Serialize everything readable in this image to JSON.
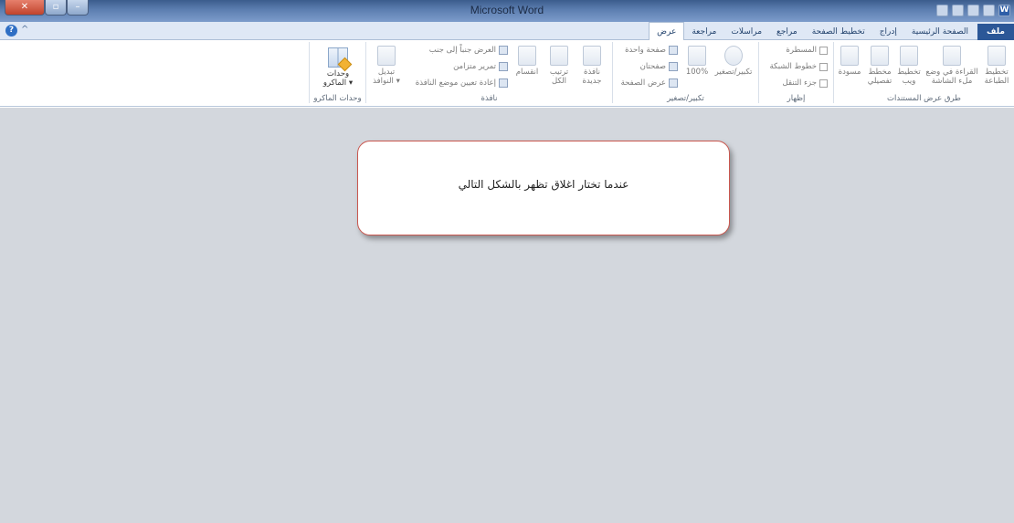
{
  "window": {
    "title": "Microsoft Word"
  },
  "tabs": [
    "ملف",
    "الصفحة الرئيسية",
    "إدراج",
    "تخطيط الصفحة",
    "مراجع",
    "مراسلات",
    "مراجعة",
    "عرض"
  ],
  "ribbon": {
    "document_views": {
      "name": "طرق عرض المستندات",
      "items": [
        "تخطيط الطباعة",
        "القراءة في وضع ملء الشاشة",
        "تخطيط ويب",
        "مخطط تفصيلي",
        "مسودة"
      ]
    },
    "show": {
      "name": "إظهار",
      "items": [
        "المسطرة",
        "خطوط الشبكة",
        "جزء التنقل"
      ]
    },
    "zoom": {
      "name": "تكبير/تصغير",
      "zoom_label": "تكبير/تصغير",
      "percent_label": "100%",
      "items": [
        "صفحة واحدة",
        "صفحتان",
        "عرض الصفحة"
      ]
    },
    "window_group": {
      "name": "نافذة",
      "new_window": "نافذة جديدة",
      "arrange_all": "ترتيب الكل",
      "split": "انقسام",
      "items": [
        "العرض جنباً إلى جنب",
        "تمرير متزامن",
        "إعادة تعيين موضع النافذة"
      ],
      "switch_windows": "تبديل النوافذ ▾"
    },
    "macros": {
      "name": "وحدات الماكرو",
      "label": "وحدات الماكرو ▾"
    }
  },
  "callout": {
    "text": "عندما تختار  اغلاق تظهر بالشكل التالي"
  }
}
